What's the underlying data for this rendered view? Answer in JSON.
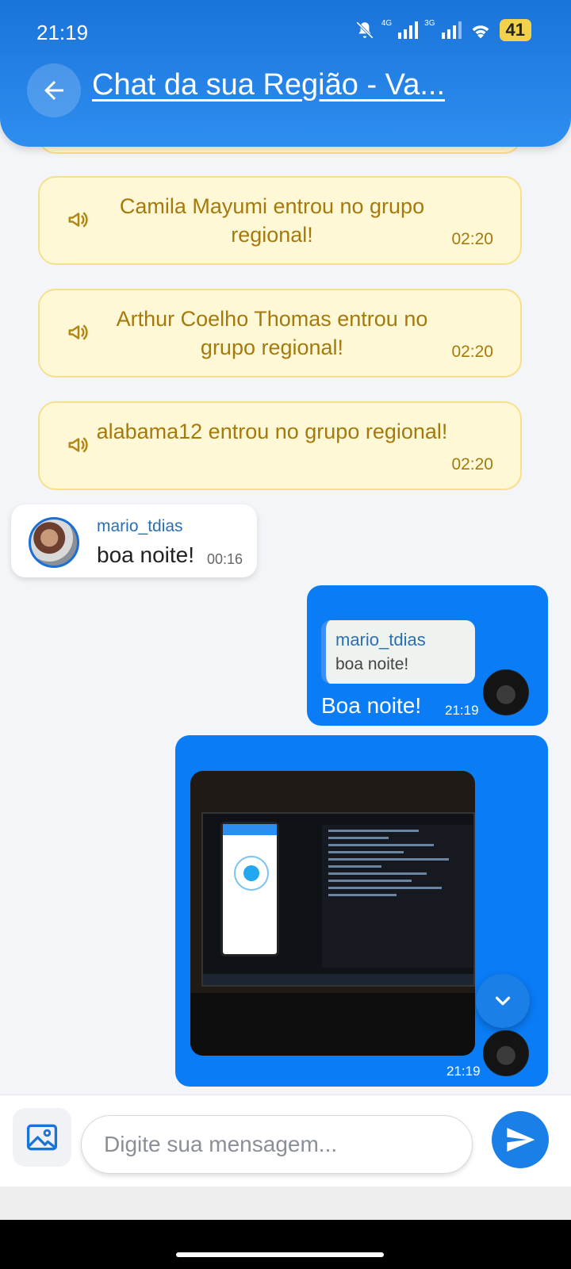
{
  "status_bar": {
    "time": "21:19",
    "net1": "4G",
    "net2": "3G",
    "battery": "41"
  },
  "header": {
    "title": "Chat da sua Região - Va..."
  },
  "notices": [
    {
      "text": "Camila Mayumi entrou no grupo regional!",
      "time": "02:20"
    },
    {
      "text": "Arthur Coelho Thomas entrou no grupo regional!",
      "time": "02:20"
    },
    {
      "text": "alabama12 entrou no grupo regional!",
      "time": "02:20"
    }
  ],
  "incoming": {
    "user": "mario_tdias",
    "text": "boa noite!",
    "time": "00:16"
  },
  "outgoing": [
    {
      "quote_user": "mario_tdias",
      "quote_text": "boa noite!",
      "text": "Boa noite!",
      "time": "21:19"
    },
    {
      "type": "image",
      "time": "21:19"
    }
  ],
  "composer": {
    "placeholder": "Digite sua mensagem..."
  },
  "colors": {
    "header": "#1a73d9",
    "bubble_out": "#0a7cf6",
    "notice_bg": "#fff8d6",
    "notice_text": "#a47a0c"
  },
  "icons": [
    "back-arrow-icon",
    "megaphone-icon",
    "image-icon",
    "send-icon",
    "chevron-down-icon",
    "wifi-icon",
    "muted-bell-icon"
  ]
}
